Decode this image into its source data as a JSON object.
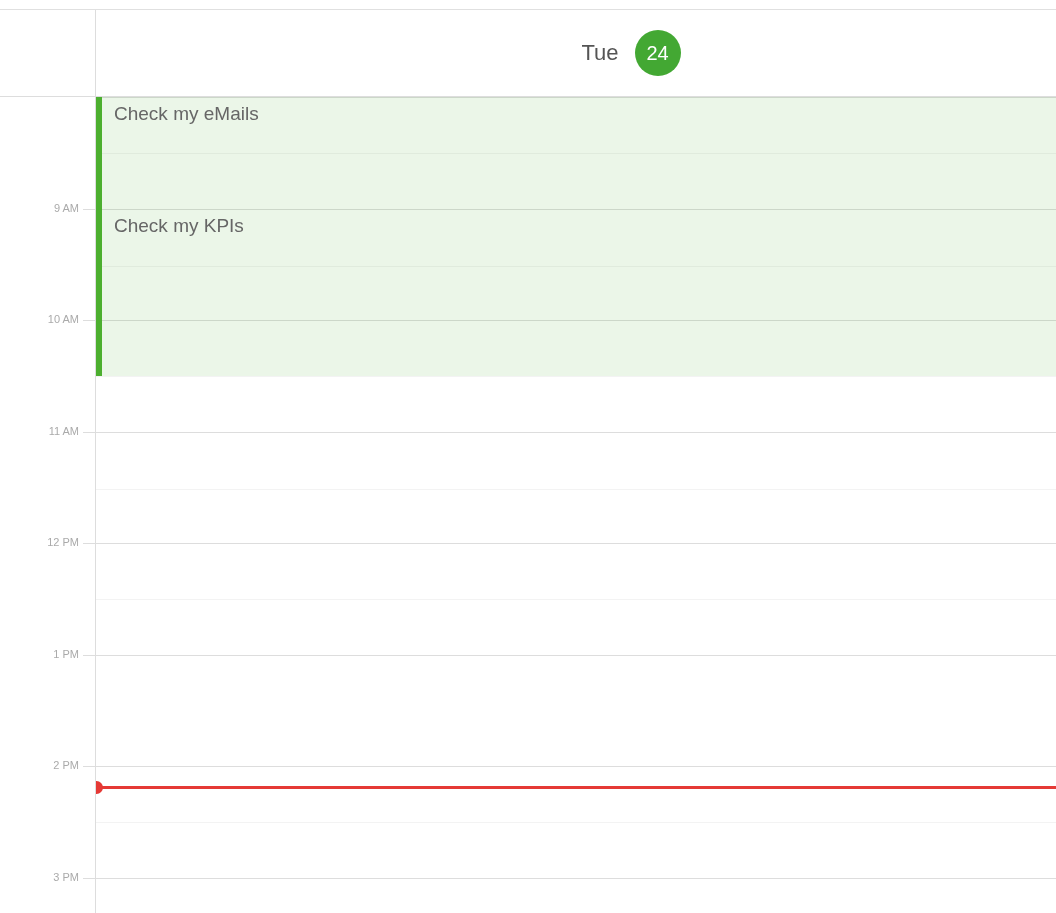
{
  "day_header": {
    "weekday": "Tue",
    "date": "24",
    "today": true
  },
  "hours": [
    {
      "label": "9 AM",
      "now": false
    },
    {
      "label": "10 AM",
      "now": false
    },
    {
      "label": "11 AM",
      "now": false
    },
    {
      "label": "12 PM",
      "now": false
    },
    {
      "label": "1 PM",
      "now": false
    },
    {
      "label": "2 PM",
      "now": true
    },
    {
      "label": "3 PM",
      "now": false
    }
  ],
  "events": [
    {
      "title": "Check my eMails",
      "kind": "hour",
      "color": "#4caf2f"
    },
    {
      "title": "Check my KPIs",
      "kind": "ninety-minutes",
      "color": "#4caf2f"
    }
  ]
}
